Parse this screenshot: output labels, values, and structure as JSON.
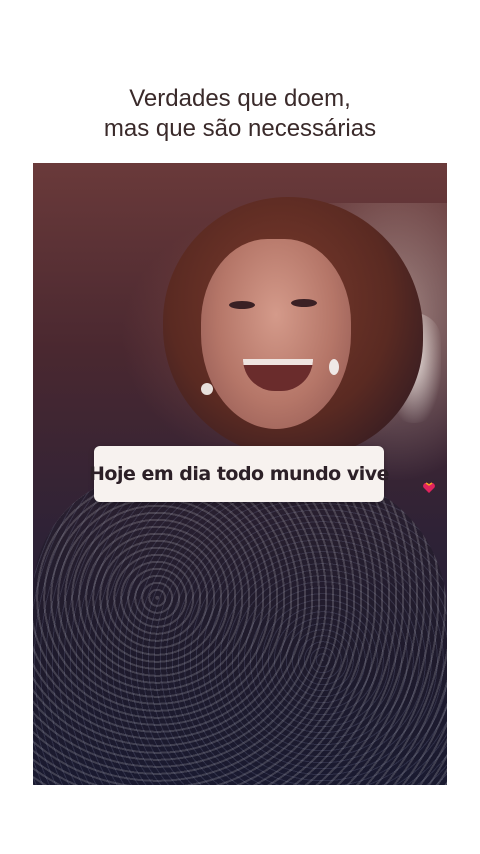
{
  "header": {
    "line1": "Verdades que doem,",
    "line2": "mas que são necessárias"
  },
  "video": {
    "caption": "Hoje em dia todo mundo vive",
    "caption_emoji_icon": "heart-with-ribbon-icon"
  },
  "colors": {
    "header_text": "#3a2a2a",
    "caption_bg": "#f7f2ef",
    "caption_text": "#2c2027"
  }
}
